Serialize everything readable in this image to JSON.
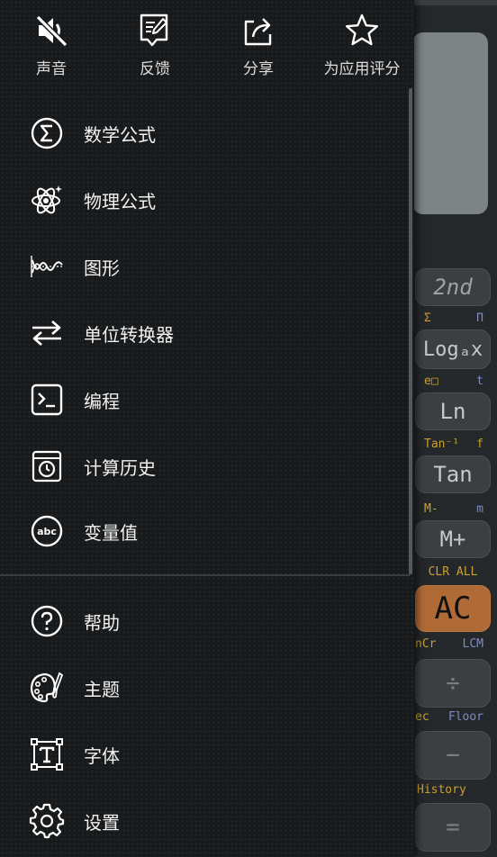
{
  "top_actions": [
    {
      "label": "声音",
      "icon": "sound-muted-icon"
    },
    {
      "label": "反馈",
      "icon": "feedback-icon"
    },
    {
      "label": "分享",
      "icon": "share-icon"
    },
    {
      "label": "为应用评分",
      "icon": "star-icon"
    }
  ],
  "menu": [
    {
      "label": "数学公式",
      "icon": "sigma-icon"
    },
    {
      "label": "物理公式",
      "icon": "atom-icon"
    },
    {
      "label": "图形",
      "icon": "graph-wave-icon"
    },
    {
      "label": "单位转换器",
      "icon": "convert-arrows-icon"
    },
    {
      "label": "编程",
      "icon": "terminal-icon"
    },
    {
      "label": "计算历史",
      "icon": "history-clock-icon"
    },
    {
      "label": "变量值",
      "icon": "abc-icon"
    }
  ],
  "menu2": [
    {
      "label": "帮助",
      "icon": "help-icon"
    },
    {
      "label": "主题",
      "icon": "palette-icon"
    },
    {
      "label": "字体",
      "icon": "font-icon"
    },
    {
      "label": "设置",
      "icon": "gear-icon"
    }
  ],
  "calc": {
    "key_2nd": "2nd",
    "sub1_left": "Σ",
    "sub1_right": "Π",
    "key_log": "Logₐx",
    "sub2_left": "e□",
    "sub2_right": "t",
    "key_ln": "Ln",
    "sub3_left": "Tan⁻¹",
    "sub3_right": "f",
    "key_tan": "Tan",
    "sub4_left": "M-",
    "sub4_right": "m",
    "key_mplus": "M+",
    "sub5": "CLR ALL",
    "key_ac": "AC",
    "sub6_left": "nCr",
    "sub6_right": "LCM",
    "key_div": "÷",
    "sub7_left": "ec",
    "sub7_right": "Floor",
    "key_minus": "−",
    "sub8": "History",
    "key_eq": "="
  },
  "colors": {
    "drawer_bg": "#17191b",
    "ac_key": "#b06a35",
    "secondary_yellow": "#caa02e",
    "secondary_blue": "#7f8bc4"
  }
}
